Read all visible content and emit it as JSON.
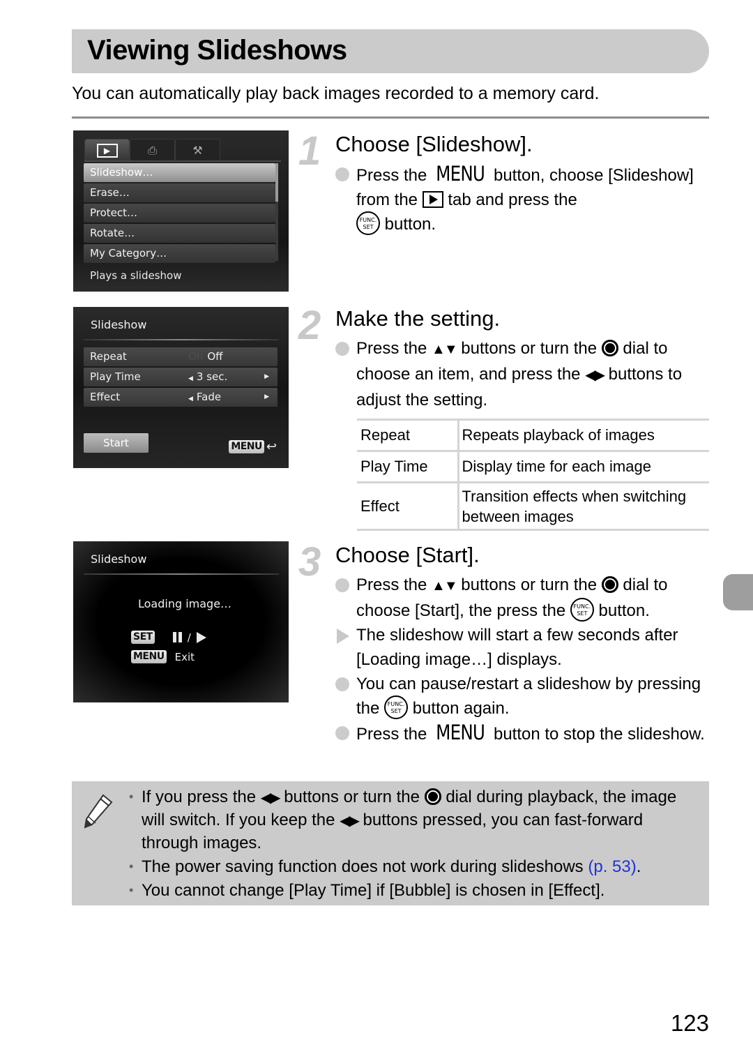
{
  "page": {
    "title": "Viewing Slideshows",
    "intro": "You can automatically play back images recorded to a memory card.",
    "page_number": "123"
  },
  "screens": {
    "menu": {
      "tabs": [
        {
          "icon": "playback-tab-icon",
          "glyph": "▶",
          "active": true
        },
        {
          "icon": "print-tab-icon",
          "glyph": "⎙",
          "active": false
        },
        {
          "icon": "settings-tab-icon",
          "glyph": "⚒",
          "active": false
        }
      ],
      "items": [
        "Slideshow…",
        "Erase…",
        "Protect…",
        "Rotate…",
        "My Category…"
      ],
      "selected_index": 0,
      "description": "Plays a slideshow"
    },
    "settings": {
      "title": "Slideshow",
      "rows": [
        {
          "label": "Repeat",
          "dim_option": "On",
          "value": "Off"
        },
        {
          "label": "Play Time",
          "value": "3 sec."
        },
        {
          "label": "Effect",
          "value": "Fade"
        }
      ],
      "start_label": "Start",
      "menu_key": "MENU",
      "back_glyph": "↩"
    },
    "loading": {
      "title": "Slideshow",
      "message": "Loading image…",
      "set_key": "SET",
      "slash": "/",
      "menu_key": "MENU",
      "exit_label": "Exit"
    }
  },
  "steps": [
    {
      "number": "1",
      "title": "Choose [Slideshow].",
      "bullets": [
        {
          "parts": [
            "Press the ",
            "MENU",
            " button, choose [Slideshow] from the ",
            " tab and press the ",
            " button."
          ]
        }
      ]
    },
    {
      "number": "2",
      "title": "Make the setting.",
      "bullets": [
        {
          "parts": [
            "Press the ",
            "▲▼",
            " buttons or turn the ",
            " dial to choose an item, and press the ",
            "◀▶",
            " buttons to adjust the setting."
          ]
        }
      ],
      "table": [
        {
          "item": "Repeat",
          "desc": "Repeats playback of images"
        },
        {
          "item": "Play Time",
          "desc": "Display time for each image"
        },
        {
          "item": "Effect",
          "desc": "Transition effects when switching between images"
        }
      ]
    },
    {
      "number": "3",
      "title": "Choose [Start].",
      "bullets": [
        {
          "parts": [
            "Press the ",
            "▲▼",
            " buttons or turn the ",
            " dial to choose [Start], the press the ",
            " button."
          ]
        },
        {
          "parts": [
            "The slideshow will start a few seconds after [Loading image…] displays."
          ]
        },
        {
          "parts": [
            "You can pause/restart a slideshow by pressing the ",
            " button again."
          ]
        },
        {
          "parts": [
            "Press the ",
            "MENU",
            " button to stop the slideshow."
          ]
        }
      ]
    }
  ],
  "func_icon": {
    "top": "FUNC.",
    "bottom": "SET"
  },
  "notes": {
    "items": [
      {
        "parts": [
          "If you press the ",
          "◀▶",
          " buttons or turn the ",
          " dial during playback, the image will switch. If you keep the ",
          "◀▶",
          " buttons pressed, you can fast-forward through images."
        ]
      },
      {
        "parts": [
          "The power saving function does not work during slideshows ",
          "(p. 53)",
          "."
        ]
      },
      {
        "parts": [
          "You cannot change [Play Time] if [Bubble] is chosen in [Effect]."
        ]
      }
    ],
    "link_color": "#1e33d8"
  },
  "colors": {
    "title_bar": "#cbcbcb",
    "notes_bg": "#cbcbcb",
    "side_tab": "#9e9e9e",
    "step_number": "#c8c8c8"
  }
}
